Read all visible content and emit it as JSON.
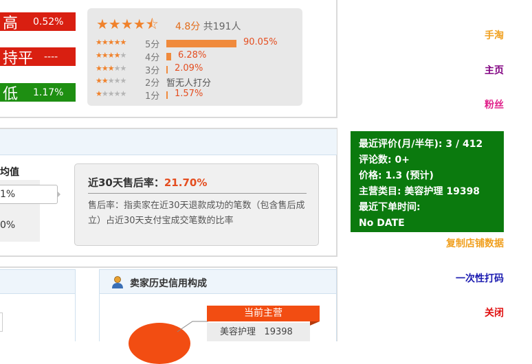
{
  "compare": [
    {
      "label": "高",
      "pct": "0.52%",
      "tone": "red"
    },
    {
      "label": "持平",
      "pct": "----",
      "tone": "red"
    },
    {
      "label": "低",
      "pct": "1.17%",
      "tone": "green"
    }
  ],
  "rating": {
    "score": "4.8分",
    "count": "共191人",
    "rows": [
      {
        "label": "5分",
        "value": "90.05%",
        "fraction": 0.9005
      },
      {
        "label": "4分",
        "value": "6.28%",
        "fraction": 0.0628
      },
      {
        "label": "3分",
        "value": "2.09%",
        "fraction": 0.0209
      },
      {
        "label": "2分",
        "value": "暂无人打分",
        "fraction": 0
      },
      {
        "label": "1分",
        "value": "1.57%",
        "fraction": 0.0157
      }
    ]
  },
  "middle": {
    "avg_label": "均值",
    "cells": [
      "1%",
      "0%"
    ],
    "after_sales_label": "近30天售后率：",
    "after_sales_rate": "21.70%",
    "after_sales_desc": "售后率：指卖家在近30天退款成功的笔数（包含售后成立）占近30天支付宝成交笔数的比率"
  },
  "credit": {
    "title": "卖家历史信用构成",
    "current_main": "当前主营",
    "main_category": "美容护理",
    "main_count": "19398"
  },
  "sidebar": {
    "links": [
      "手淘",
      "主页",
      "粉丝"
    ],
    "info_lines": [
      "最近评价(月/半年): 3 / 412",
      "评论数: 0+",
      "价格: 1.3 (预计)",
      "主营类目: 美容护理 19398",
      "最近下单时间:",
      "No DATE"
    ],
    "copy_label": "复制店铺数据",
    "print_label": "一次性打码",
    "close_label": "关闭"
  },
  "colors": {
    "accent_orange": "#f0822c",
    "rate_red": "#e44d1f",
    "info_green": "#0b7a0e",
    "link_orange": "#f0a020",
    "link_purple": "#800080",
    "link_pink": "#e0208a",
    "link_blue": "#1a1ab0",
    "link_red": "#e01010"
  }
}
